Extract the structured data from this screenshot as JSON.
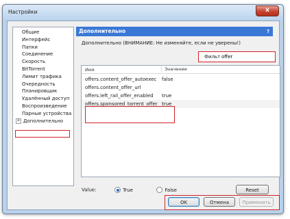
{
  "window": {
    "title": "Настройки",
    "close_label": "x"
  },
  "sidebar": {
    "items": [
      {
        "label": "Общие"
      },
      {
        "label": "Интерфейс"
      },
      {
        "label": "Папки"
      },
      {
        "label": "Соединение"
      },
      {
        "label": "Скорость"
      },
      {
        "label": "BitTorrent"
      },
      {
        "label": "Лимит трафика"
      },
      {
        "label": "Очередность"
      },
      {
        "label": "Планировщик"
      },
      {
        "label": "Удалённый доступ"
      },
      {
        "label": "Воспроизведение"
      },
      {
        "label": "Парные устройства"
      },
      {
        "label": "Дополнительно",
        "expander": "+"
      }
    ]
  },
  "panel": {
    "header": "Дополнительно",
    "help": "?",
    "warning": "Дополнительно (ВНИМАНИЕ: Не изменяйте, если не уверены!)",
    "filter_label": "Фильт",
    "filter_value": "offer"
  },
  "table": {
    "columns": [
      "Имя",
      "Значение"
    ],
    "rows": [
      {
        "name": "offers.content_offer_autoexec",
        "value": "false"
      },
      {
        "name": "offers.content_offer_url",
        "value": ""
      },
      {
        "name": "offers.left_rail_offer_enabled",
        "value": "true"
      },
      {
        "name": "offers.sponsored_torrent_offer...",
        "value": "true"
      }
    ]
  },
  "value_controls": {
    "label": "Value:",
    "true_label": "True",
    "false_label": "False",
    "selected": "True",
    "reset_label": "Reset"
  },
  "footer": {
    "ok_label": "OK",
    "cancel_label": "Отмена",
    "apply_label": "Применить"
  }
}
